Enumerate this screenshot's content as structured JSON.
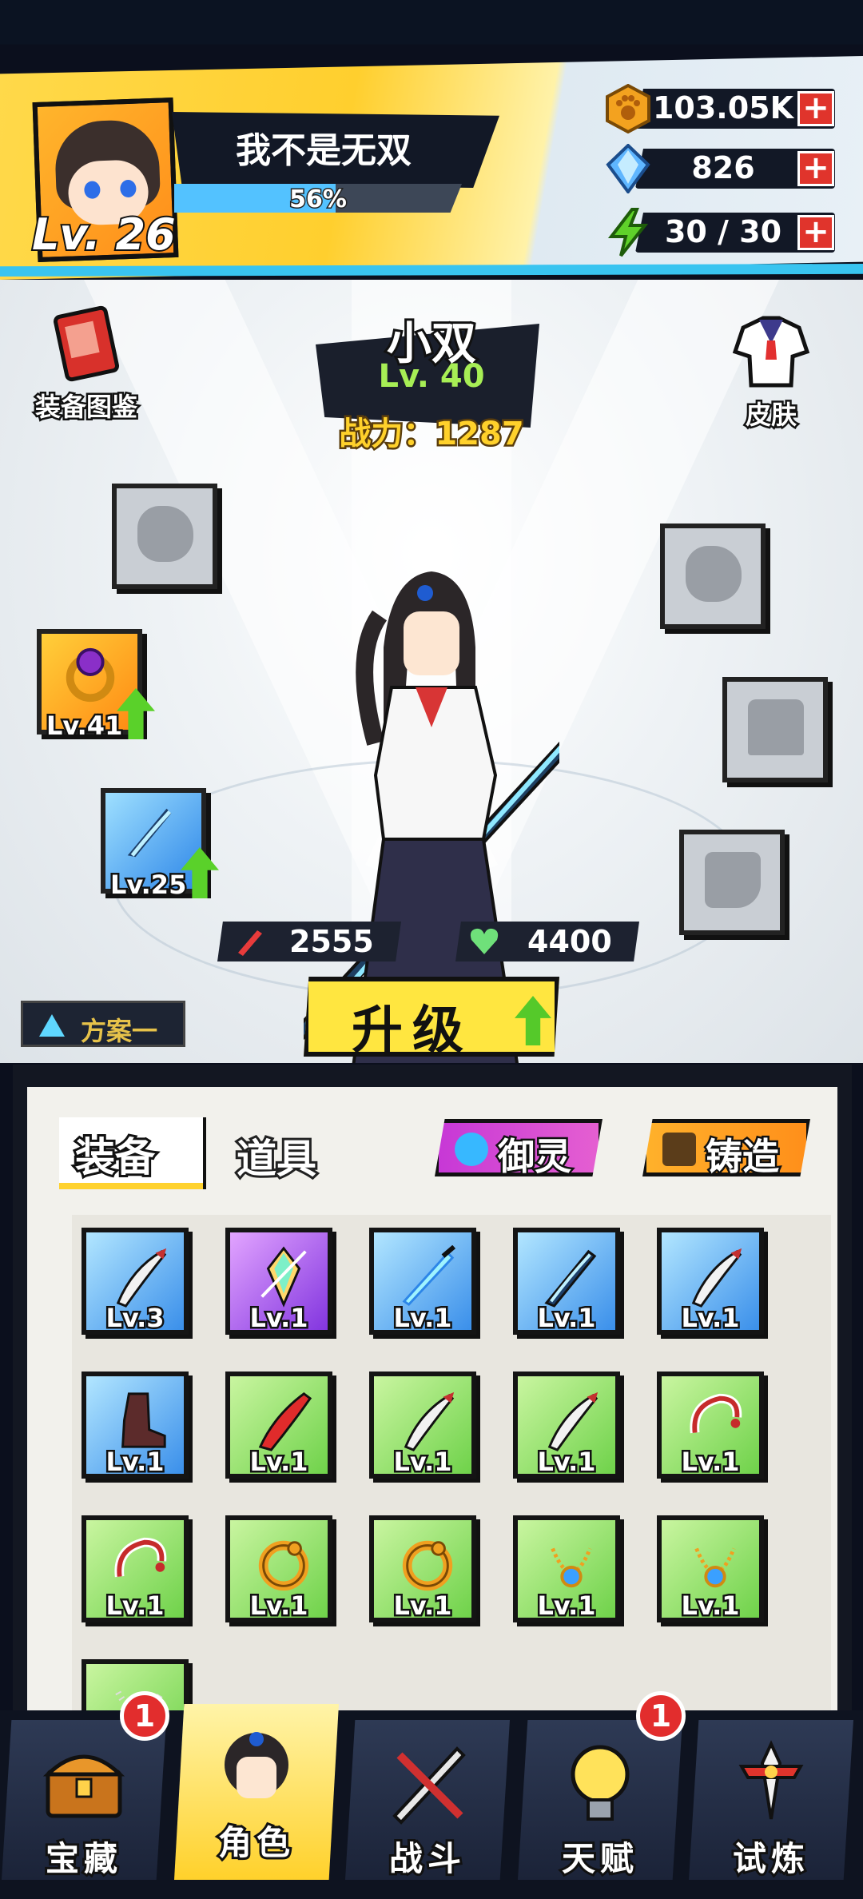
{
  "player": {
    "name": "我不是无双",
    "level_label": "Lv. 26",
    "exp_percent_label": "56%",
    "exp_fraction": 0.56
  },
  "resources": [
    {
      "name": "paw-coin",
      "value": "103.05K",
      "icon": "paw-coin-icon",
      "color": "#f3a21f"
    },
    {
      "name": "diamond",
      "value": "826",
      "icon": "diamond-icon",
      "color": "#5fb6ff"
    },
    {
      "name": "energy",
      "value": "30 / 30",
      "icon": "lightning-icon",
      "color": "#5fd12a"
    }
  ],
  "side_buttons": {
    "equipment_atlas": "装备图鉴",
    "skin": "皮肤"
  },
  "hero": {
    "name": "小双",
    "level": "Lv. 40",
    "power": "战力：1287",
    "attack": "2555",
    "hp": "4400"
  },
  "slots": {
    "ring_level": "Lv.41",
    "weapon_level": "Lv.25"
  },
  "scheme_label": "方案一",
  "upgrade_label": "升级",
  "tabs": {
    "equipment": "装备",
    "items": "道具",
    "spirit": "御灵",
    "forge": "铸造"
  },
  "inventory": [
    {
      "art": "blade-icon",
      "rarity": "blue",
      "level": "Lv.3"
    },
    {
      "art": "crystal-icon",
      "rarity": "purple",
      "level": "Lv.1"
    },
    {
      "art": "light-sword-icon",
      "rarity": "blue",
      "level": "Lv.1"
    },
    {
      "art": "jagged-sword-icon",
      "rarity": "blue",
      "level": "Lv.1"
    },
    {
      "art": "blade-icon",
      "rarity": "blue",
      "level": "Lv.1"
    },
    {
      "art": "boot-icon",
      "rarity": "blue",
      "level": "Lv.1"
    },
    {
      "art": "red-blade-icon",
      "rarity": "green",
      "level": "Lv.1"
    },
    {
      "art": "blade-icon",
      "rarity": "green",
      "level": "Lv.1"
    },
    {
      "art": "blade-icon",
      "rarity": "green",
      "level": "Lv.1"
    },
    {
      "art": "ring-icon",
      "rarity": "green",
      "level": "Lv.1"
    },
    {
      "art": "ring-icon",
      "rarity": "green",
      "level": "Lv.1"
    },
    {
      "art": "dragon-ring-icon",
      "rarity": "green",
      "level": "Lv.1"
    },
    {
      "art": "dragon-ring-icon",
      "rarity": "green",
      "level": "Lv.1"
    },
    {
      "art": "necklace-icon",
      "rarity": "green",
      "level": "Lv.1"
    },
    {
      "art": "necklace-icon",
      "rarity": "green",
      "level": "Lv.1"
    },
    {
      "art": "pearl-necklace-icon",
      "rarity": "green",
      "level": ""
    }
  ],
  "nav": [
    {
      "label": "宝藏",
      "icon": "treasure-chest-icon",
      "badge": "1",
      "active": false
    },
    {
      "label": "角色",
      "icon": "character-portrait-icon",
      "badge": "",
      "active": true
    },
    {
      "label": "战斗",
      "icon": "battle-swords-icon",
      "badge": "",
      "active": false
    },
    {
      "label": "天赋",
      "icon": "lightbulb-icon",
      "badge": "1",
      "active": false
    },
    {
      "label": "试炼",
      "icon": "trial-sword-icon",
      "badge": "",
      "active": false
    }
  ],
  "colors": {
    "accent_yellow": "#ffd22e",
    "badge_red": "#e22d2d",
    "level_green": "#a7ee55",
    "power_gold": "#ffd12b"
  }
}
